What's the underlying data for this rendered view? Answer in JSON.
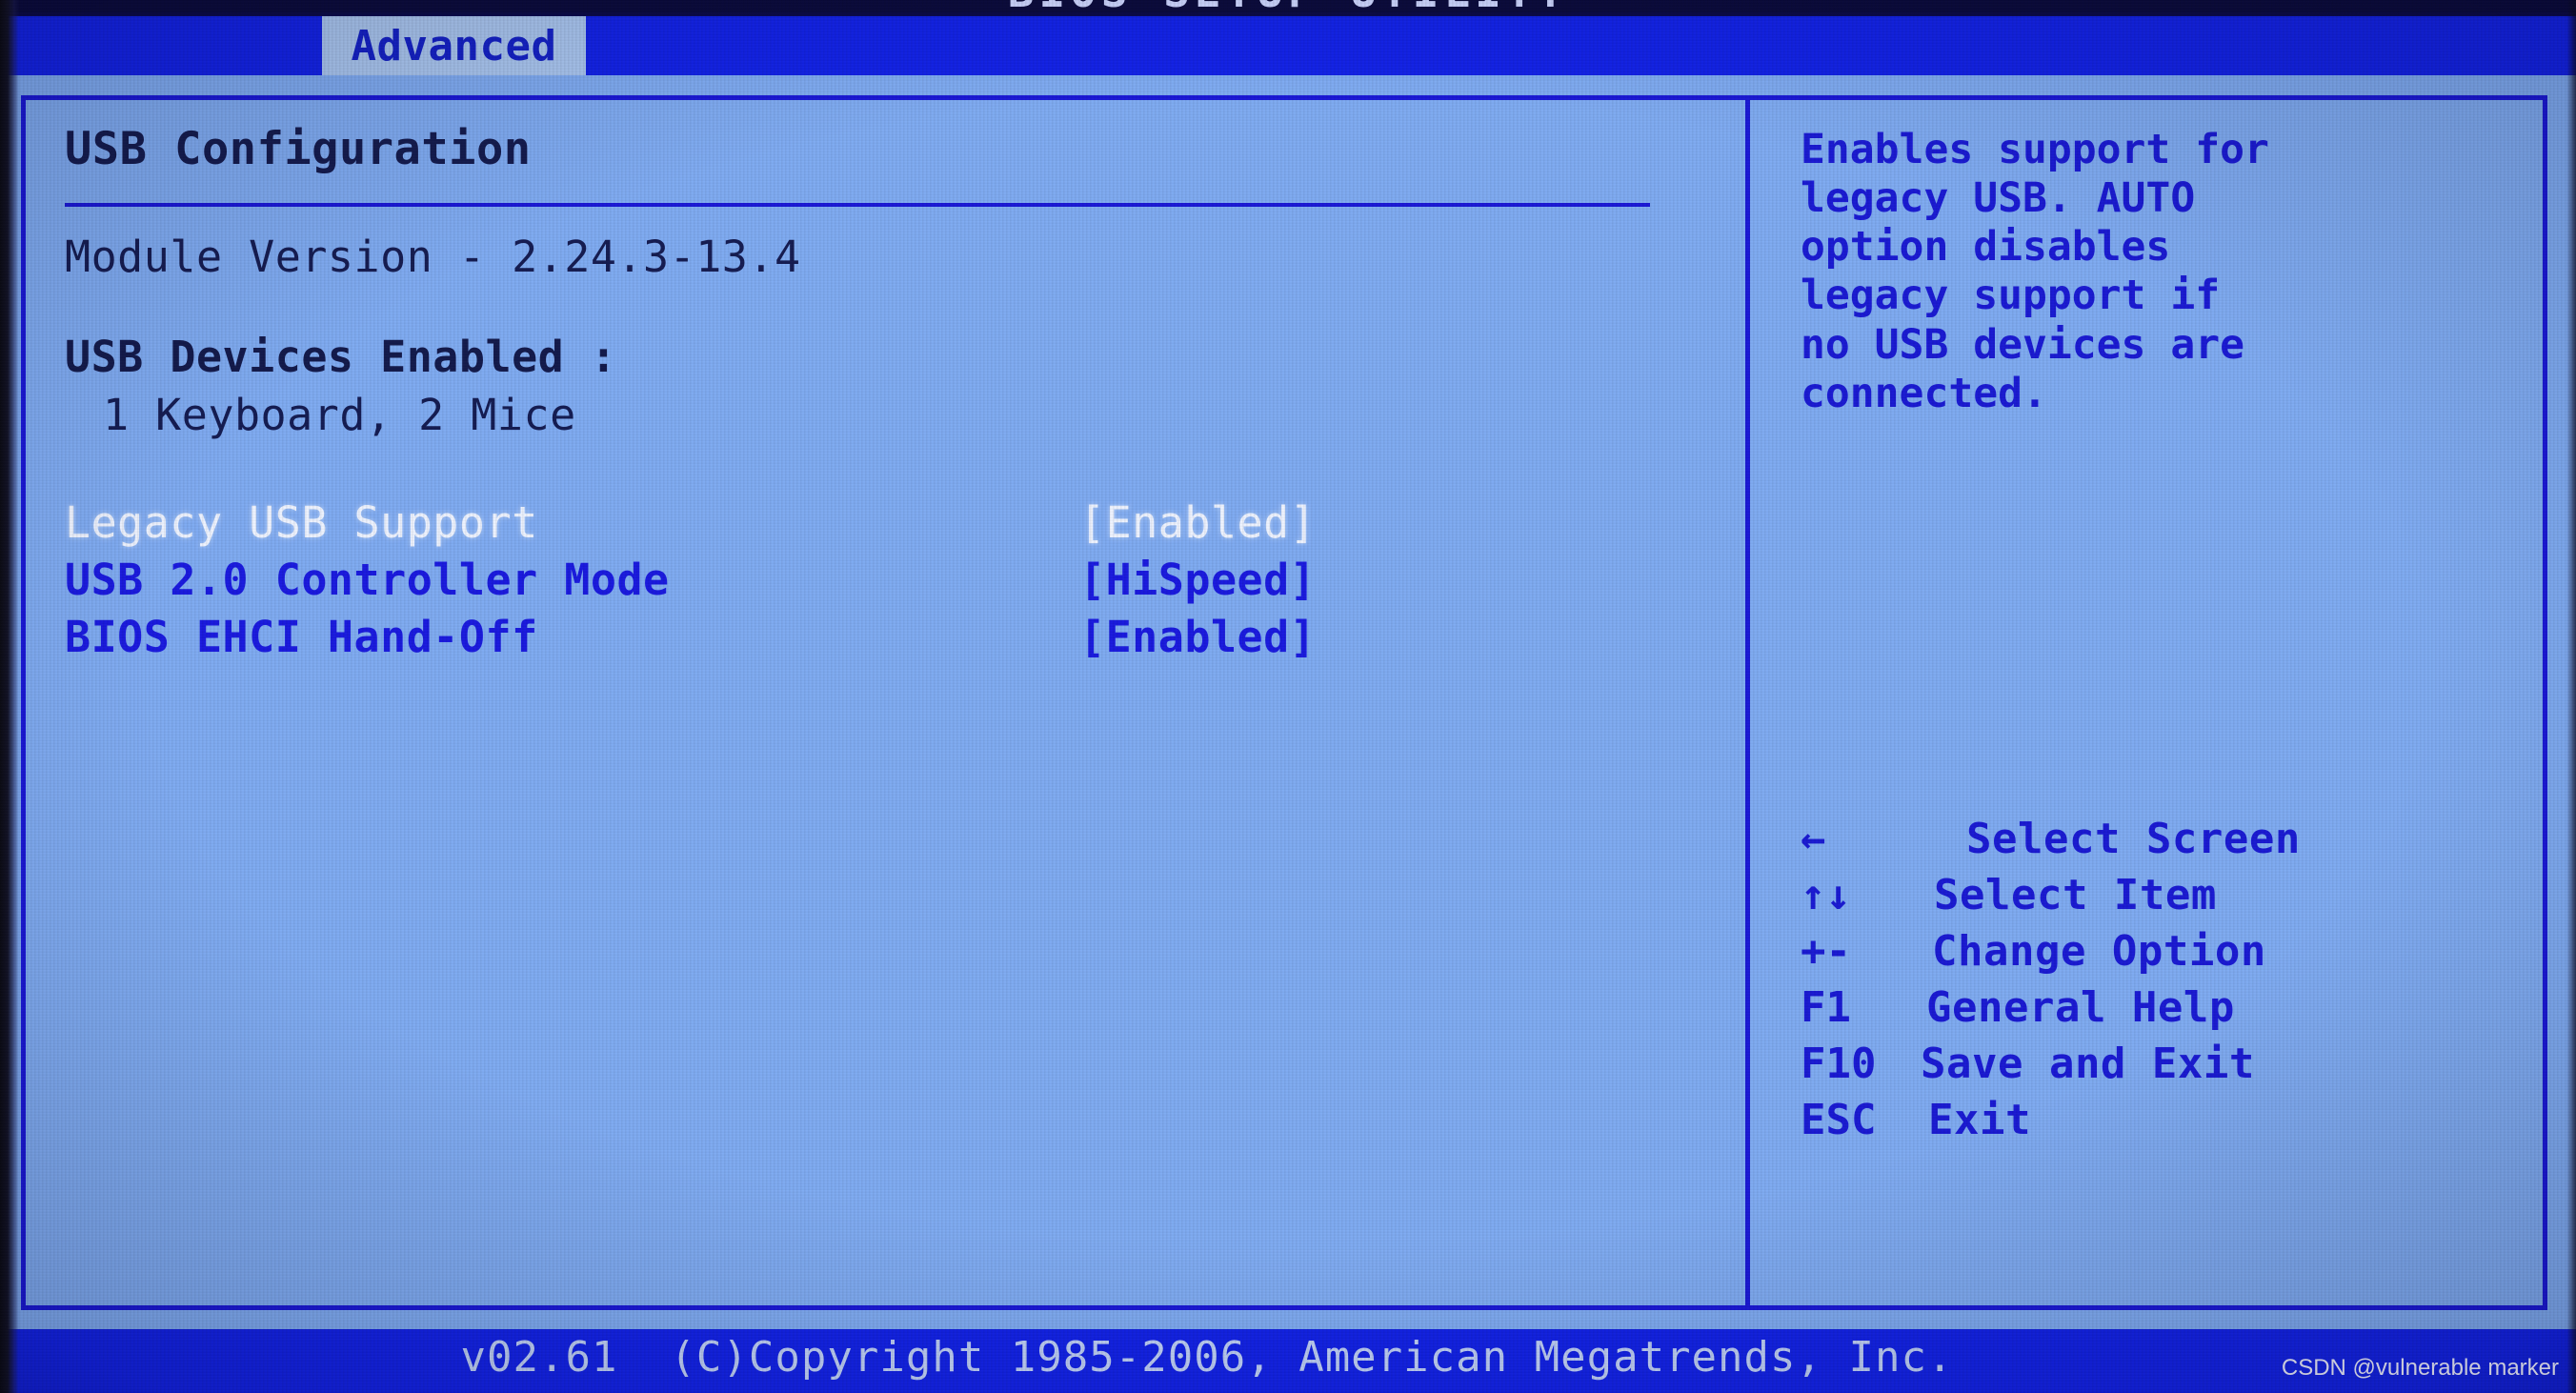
{
  "window": {
    "title": "BIOS SETUP UTILITY"
  },
  "tabs": [
    {
      "label": "Advanced",
      "active": true
    }
  ],
  "main": {
    "section_title": "USB Configuration",
    "module_version": "Module Version - 2.24.3-13.4",
    "devices_enabled_label": "USB Devices Enabled :",
    "devices_enabled_value": "1 Keyboard, 2 Mice",
    "settings": [
      {
        "label": "Legacy USB Support",
        "value": "[Enabled]",
        "selected": true
      },
      {
        "label": "USB 2.0 Controller Mode",
        "value": "[HiSpeed]",
        "selected": false
      },
      {
        "label": "BIOS EHCI Hand-Off",
        "value": "[Enabled]",
        "selected": false
      }
    ]
  },
  "help": {
    "lines": [
      "Enables support for",
      "legacy USB. AUTO",
      "option disables",
      "legacy support if",
      "no USB devices are",
      "connected."
    ]
  },
  "keys": [
    {
      "glyph": "←",
      "desc": "Select Screen"
    },
    {
      "glyph": "↑↓",
      "desc": "Select Item"
    },
    {
      "glyph": "+-",
      "desc": "Change Option"
    },
    {
      "glyph": "F1",
      "desc": "General Help"
    },
    {
      "glyph": "F10",
      "desc": "Save and Exit"
    },
    {
      "glyph": "ESC",
      "desc": "Exit"
    }
  ],
  "footer": {
    "copyright": "v02.61  (C)Copyright 1985-2006, American Megatrends, Inc.",
    "watermark": "CSDN @vulnerable marker"
  },
  "colors": {
    "screen_bg": "#7fabf2",
    "chrome_blue": "#1222e8",
    "border_blue": "#1a18d8",
    "text_navy": "#141b4e",
    "text_blue": "#1a1ad4",
    "highlight_text": "#eef3ff",
    "tab_active_bg": "#a9c6f0",
    "footer_text": "#bfd0f7"
  }
}
